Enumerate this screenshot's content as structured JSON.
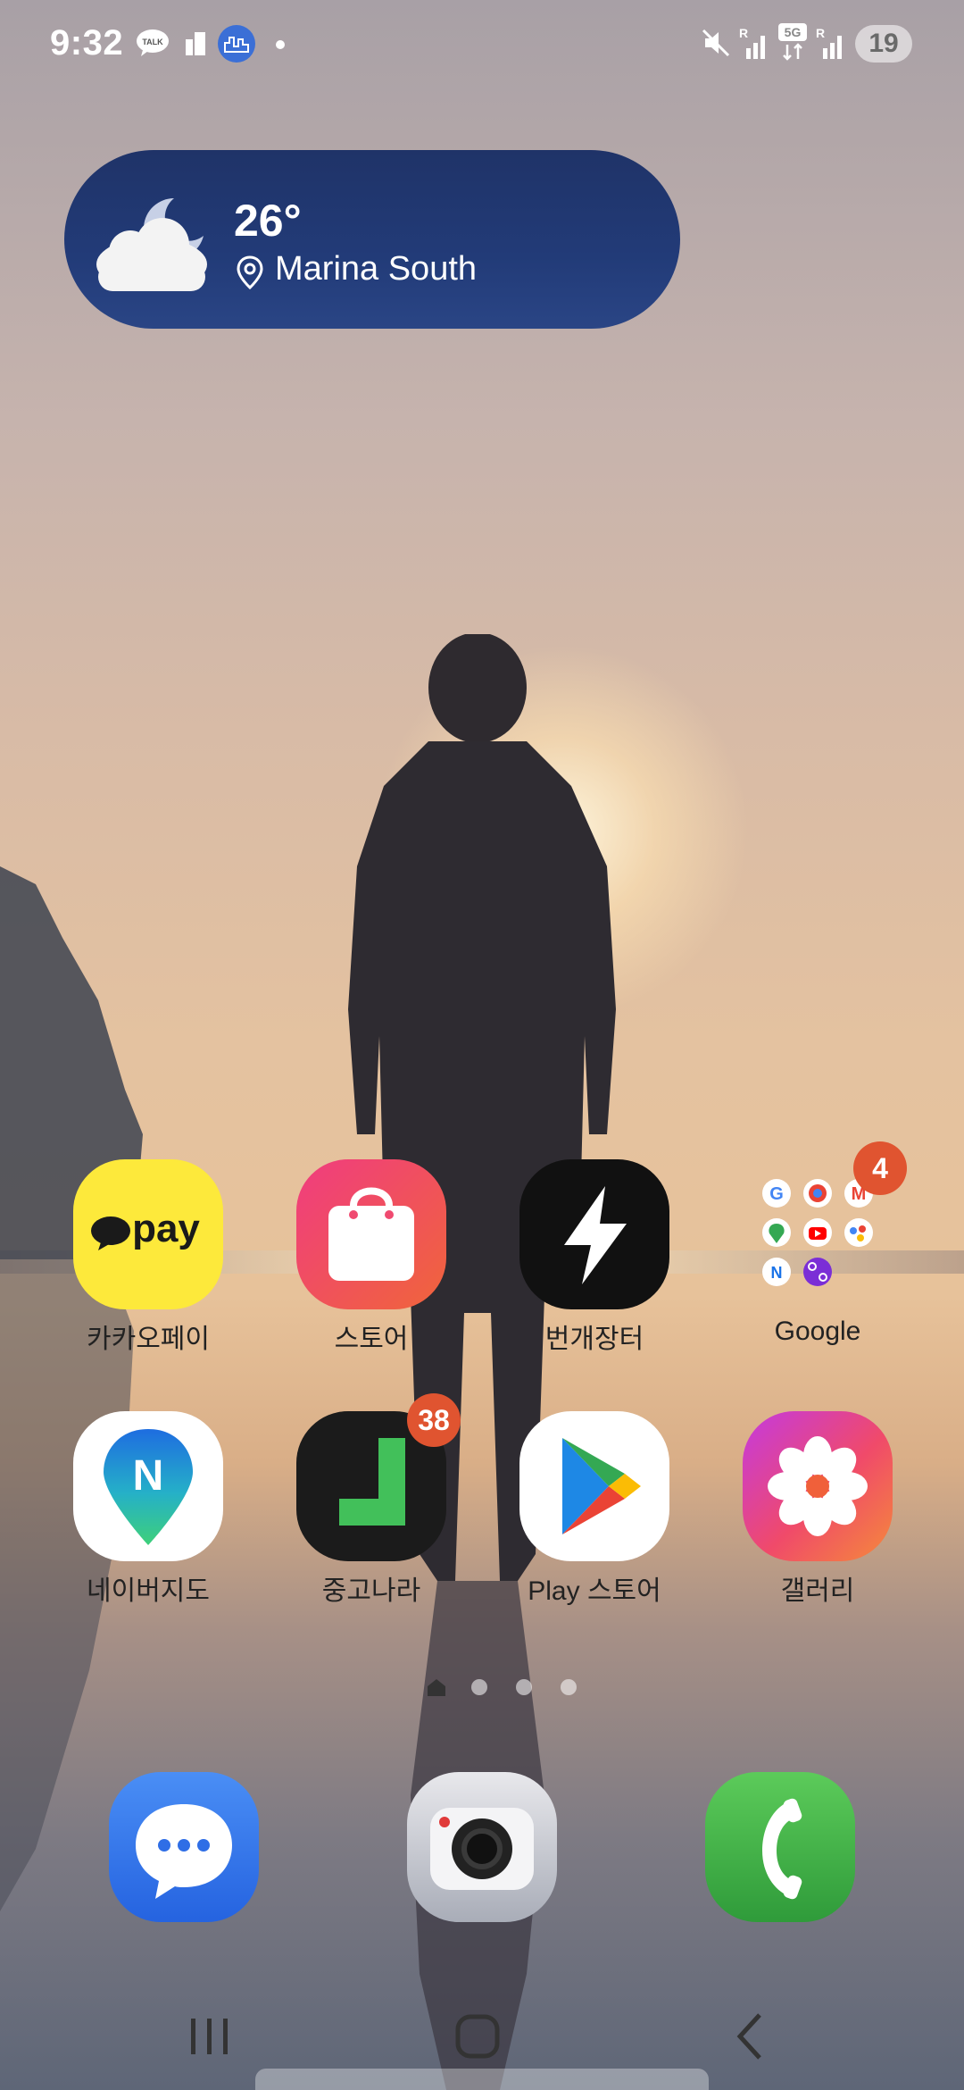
{
  "status_bar": {
    "time": "9:32",
    "notification_icons": [
      "kakaotalk-icon",
      "sim-icon",
      "city-app-icon",
      "dot-icon"
    ],
    "system_icons": [
      "mute-icon",
      "signal-r-icon",
      "5g-icon",
      "signal-r-icon"
    ],
    "battery": "19"
  },
  "weather_widget": {
    "temperature": "26°",
    "location": "Marina South",
    "condition_icon": "cloud-moon-icon"
  },
  "apps_row1": [
    {
      "label": "카카오페이",
      "icon": "kakaopay-icon",
      "badge": ""
    },
    {
      "label": "스토어",
      "icon": "store-bag-icon",
      "badge": ""
    },
    {
      "label": "번개장터",
      "icon": "bolt-icon",
      "badge": ""
    },
    {
      "label": "Google",
      "icon": "google-folder-icon",
      "badge": "4"
    }
  ],
  "apps_row2": [
    {
      "label": "네이버지도",
      "icon": "naver-map-icon",
      "badge": ""
    },
    {
      "label": "중고나라",
      "icon": "joonggonara-icon",
      "badge": "38"
    },
    {
      "label": "Play 스토어",
      "icon": "play-store-icon",
      "badge": ""
    },
    {
      "label": "갤러리",
      "icon": "gallery-flower-icon",
      "badge": ""
    }
  ],
  "kakaopay_text": "pay",
  "page_indicator": {
    "pages": 4,
    "current": 1
  },
  "dock": [
    "messages-icon",
    "camera-icon",
    "phone-icon"
  ],
  "nav_bar": [
    "recents-icon",
    "home-icon",
    "back-icon"
  ],
  "colors": {
    "weather_bg": "#223b78",
    "badge": "#e05430",
    "kakaopay_yellow": "#fde93b"
  }
}
